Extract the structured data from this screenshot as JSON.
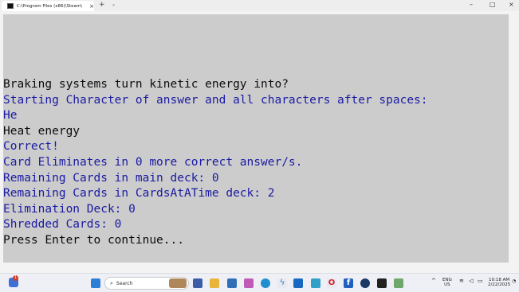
{
  "window": {
    "tab_title": "C:\\Program Files (x86)\\Steam\\",
    "tab_close": "×",
    "new_tab": "+",
    "dropdown": "⌄",
    "minimize": "–",
    "maximize": "□",
    "close": "×"
  },
  "console": {
    "lines": [
      {
        "text": "Braking systems turn kinetic energy into?",
        "color": "white"
      },
      {
        "text": "Starting Character of answer and all characters after spaces:",
        "color": "blue"
      },
      {
        "text": "He",
        "color": "blue"
      },
      {
        "text": "Heat energy",
        "color": "white"
      },
      {
        "text": "Correct!",
        "color": "blue"
      },
      {
        "text": "Card Eliminates in 0 more correct answer/s.",
        "color": "blue"
      },
      {
        "text": "Remaining Cards in main deck: 0",
        "color": "blue"
      },
      {
        "text": "Remaining Cards in CardsAtATime deck: 2",
        "color": "blue"
      },
      {
        "text": "Elimination Deck: 0",
        "color": "blue"
      },
      {
        "text": "Shredded Cards: 0",
        "color": "blue"
      },
      {
        "text": "Press Enter to continue...",
        "color": "white"
      }
    ]
  },
  "taskbar": {
    "search_placeholder": "Search",
    "notification_count": "1",
    "language_line1": "ENG",
    "language_line2": "US",
    "time": "10:18 AM",
    "date": "2/22/2025",
    "chevron": "^",
    "apps": [
      "start-icon",
      "file-explorer-icon",
      "browser-icon",
      "store-icon",
      "photos-icon",
      "edge-icon",
      "bolt-icon",
      "outlook-icon",
      "app-icon",
      "opera-icon",
      "facebook-icon",
      "steam-icon",
      "terminal-icon",
      "app2-icon"
    ]
  }
}
